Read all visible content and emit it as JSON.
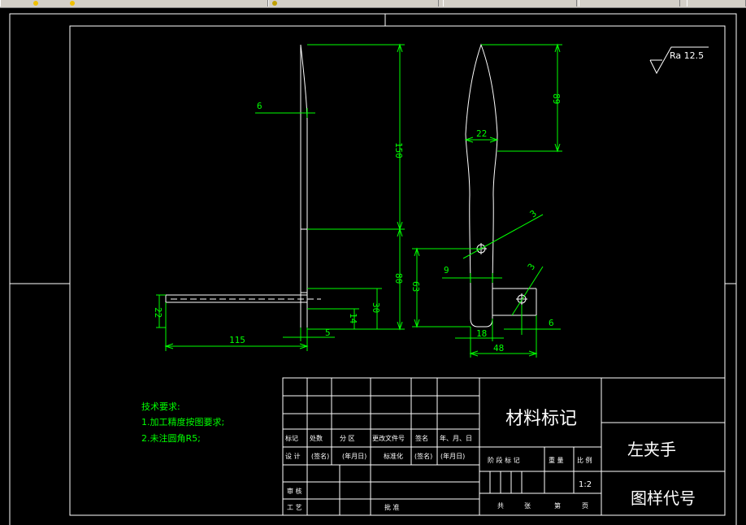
{
  "toolbar": {
    "tabs": [
      "",
      "",
      "",
      ""
    ],
    "right_button": ""
  },
  "dims": {
    "d6_top": "6",
    "d150": "150",
    "d80": "80",
    "d30": "30",
    "d14": "14",
    "d5": "5",
    "d115": "115",
    "d22_left": "22",
    "d89": "89",
    "d22_top": "22",
    "d3_big": "3",
    "d9": "9",
    "d63": "63",
    "d3_small": "3",
    "d6_right": "6",
    "d18": "18",
    "d48": "48"
  },
  "roughness": "Ra 12.5",
  "tech": {
    "title": "技术要求:",
    "line1": "1.加工精度按图要求;",
    "line2": "2.未注圆角R5;"
  },
  "titleblock": {
    "material": "材料标记",
    "part_name": "左夹手",
    "drawing_code": "图样代号",
    "scale": "1:2",
    "row_labels": [
      "标记",
      "处数",
      "分 区",
      "更改文件号",
      "签名",
      "年、月、日"
    ],
    "design_row": [
      "设 计",
      "(签名)",
      "(年月日)",
      "标准化",
      "(签名)",
      "(年月日)"
    ],
    "review": "审 核",
    "process": "工 艺",
    "approve": "批 准",
    "stage_row": [
      "阶 段 标 记",
      "重 量",
      "比 例"
    ],
    "sheet_row": [
      "共",
      "张",
      "第",
      "页"
    ]
  }
}
